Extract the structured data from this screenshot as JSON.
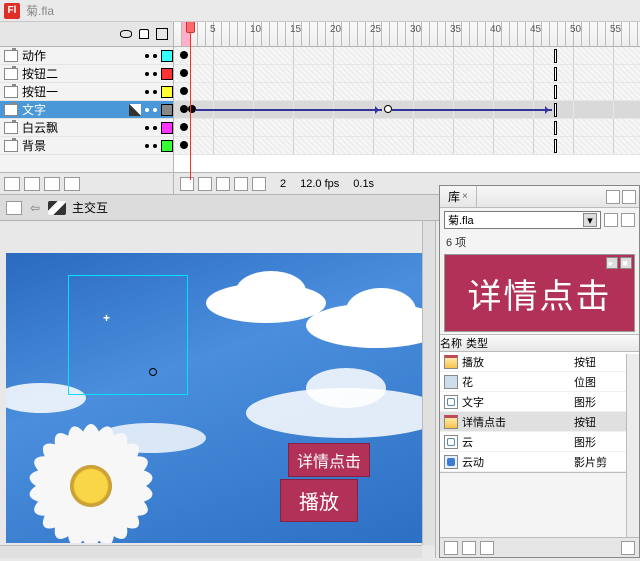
{
  "title": {
    "filename": "菊.fla",
    "app_glyph": "Fl"
  },
  "ruler": {
    "marks": [
      5,
      10,
      15,
      20,
      25,
      30,
      35,
      40,
      45,
      50,
      55
    ]
  },
  "layers": [
    {
      "name": "动作",
      "color": "#33ffff",
      "selected": false,
      "hasPencil": false
    },
    {
      "name": "按钮二",
      "color": "#ff3333",
      "selected": false,
      "hasPencil": false
    },
    {
      "name": "按钮一",
      "color": "#ffff33",
      "selected": false,
      "hasPencil": false
    },
    {
      "name": "文字",
      "color": "#888888",
      "selected": true,
      "hasPencil": true
    },
    {
      "name": "白云飘",
      "color": "#ff33ff",
      "selected": false,
      "hasPencil": false
    },
    {
      "name": "背景",
      "color": "#33ff33",
      "selected": false,
      "hasPencil": false
    }
  ],
  "timeline_status": {
    "frame": "2",
    "fps": "12.0 fps",
    "time": "0.1s"
  },
  "scene": {
    "label": "主交互"
  },
  "stage": {
    "btn_detail": "详情点击",
    "btn_play": "播放"
  },
  "library": {
    "tab": "库",
    "file": "菊.fla",
    "count": "6 项",
    "preview_text": "详情点击",
    "cols": {
      "name": "名称",
      "type": "类型"
    },
    "items": [
      {
        "name": "播放",
        "type": "按钮",
        "icon": "it-btn"
      },
      {
        "name": "花",
        "type": "位图",
        "icon": "it-bmp"
      },
      {
        "name": "文字",
        "type": "图形",
        "icon": "it-gfx"
      },
      {
        "name": "详情点击",
        "type": "按钮",
        "icon": "it-btn",
        "sel": true
      },
      {
        "name": "云",
        "type": "图形",
        "icon": "it-gfx"
      },
      {
        "name": "云动",
        "type": "影片剪",
        "icon": "it-mc"
      }
    ]
  }
}
